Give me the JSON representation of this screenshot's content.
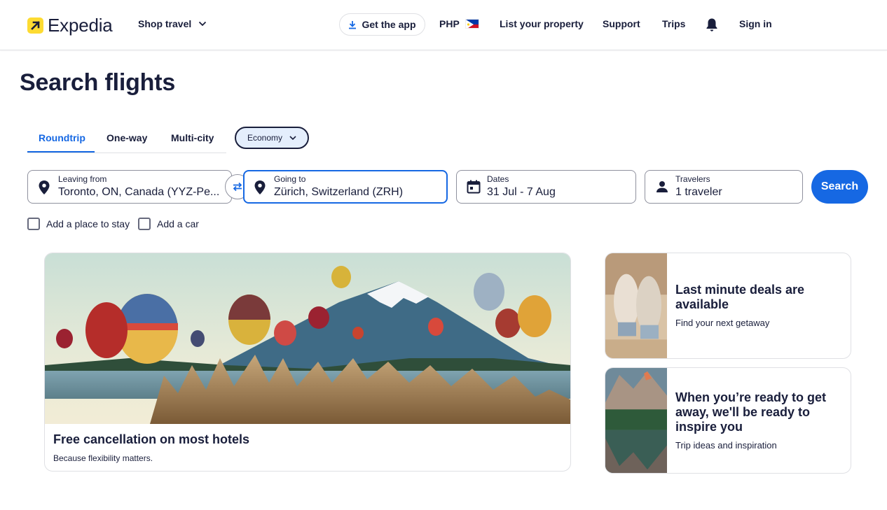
{
  "header": {
    "logo_text": "Expedia",
    "shop_travel": "Shop travel",
    "get_app": "Get the app",
    "currency": "PHP",
    "list_property": "List your property",
    "support": "Support",
    "trips": "Trips",
    "sign_in": "Sign in"
  },
  "page_title": "Search flights",
  "tabs": [
    "Roundtrip",
    "One-way",
    "Multi-city"
  ],
  "cabin_class": "Economy",
  "search_form": {
    "leaving_from": {
      "label": "Leaving from",
      "value": "Toronto, ON, Canada (YYZ-Pe..."
    },
    "going_to": {
      "label": "Going to",
      "value": "Zürich, Switzerland (ZRH)"
    },
    "dates": {
      "label": "Dates",
      "value": "31 Jul - 7 Aug"
    },
    "travelers": {
      "label": "Travelers",
      "value": "1 traveler"
    },
    "search_button": "Search"
  },
  "addons": [
    "Add a place to stay",
    "Add a car"
  ],
  "promo_cards": {
    "main": {
      "title": "Free cancellation on most hotels",
      "subtitle": "Because flexibility matters."
    },
    "side": [
      {
        "title": "Last minute deals are available",
        "subtitle": "Find your next getaway"
      },
      {
        "title": "When you’re ready to get away, we'll be ready to inspire you",
        "subtitle": "Trip ideas and inspiration"
      }
    ]
  },
  "colors": {
    "primary": "#1668e3",
    "text": "#191e3b",
    "brand_yellow": "#fddb32"
  }
}
